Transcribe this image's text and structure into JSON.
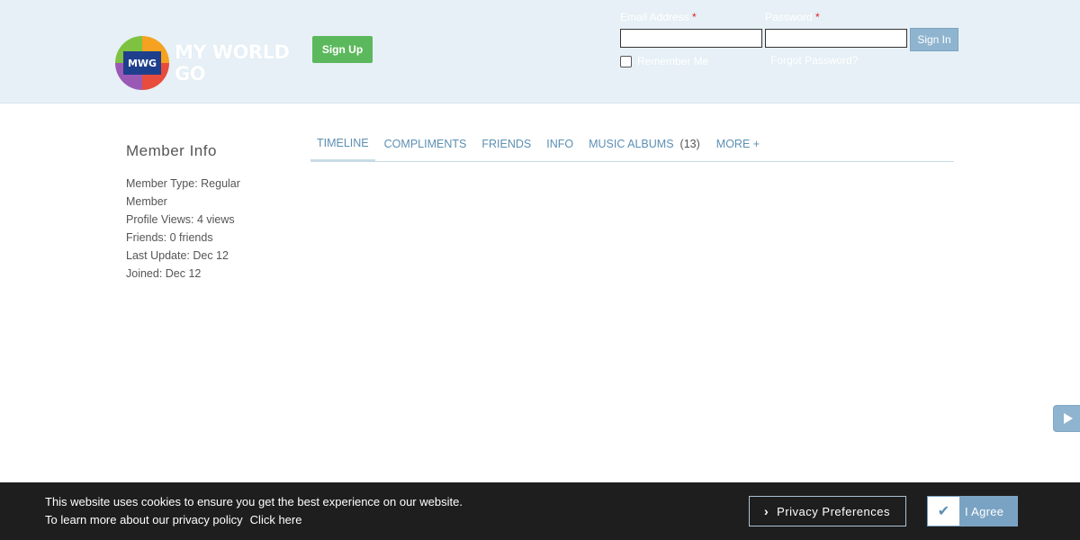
{
  "header": {
    "logo": {
      "badge_text": "MWG",
      "wordmark": "MY WORLD GO"
    },
    "signup_label": "Sign Up",
    "login": {
      "email_label": "Email Address",
      "password_label": "Password",
      "required_mark": "*",
      "email_value": "",
      "password_value": "",
      "signin_label": "Sign In",
      "remember_label": "Remember Me",
      "forgot_label": "Forgot Password?"
    }
  },
  "sidebar": {
    "title": "Member Info",
    "items": [
      "Member Type: Regular Member",
      "Profile Views: 4 views",
      "Friends: 0 friends",
      "Last Update: Dec 12",
      "Joined: Dec 12"
    ]
  },
  "tabs": [
    {
      "label": "Timeline",
      "active": true
    },
    {
      "label": "Compliments"
    },
    {
      "label": "Friends"
    },
    {
      "label": "Info"
    },
    {
      "label": "Music Albums",
      "count": "(13)"
    },
    {
      "label": "More +"
    }
  ],
  "side_button": {
    "icon": "play-icon"
  },
  "cookie_bar": {
    "line1": "This website uses cookies to ensure you get the best experience on our website.",
    "line2": "To learn more about our privacy policy",
    "link_label": "Click here",
    "privacy_label": "Privacy Preferences",
    "agree_label": "I Agree"
  },
  "colors": {
    "header_bg": "#e6f0f6",
    "signup_green": "#5cb85c",
    "accent_blue": "#5b8fb3",
    "button_blue": "#8fb4cf",
    "cookie_bg": "#1e1e1e",
    "required_red": "#e02020"
  }
}
